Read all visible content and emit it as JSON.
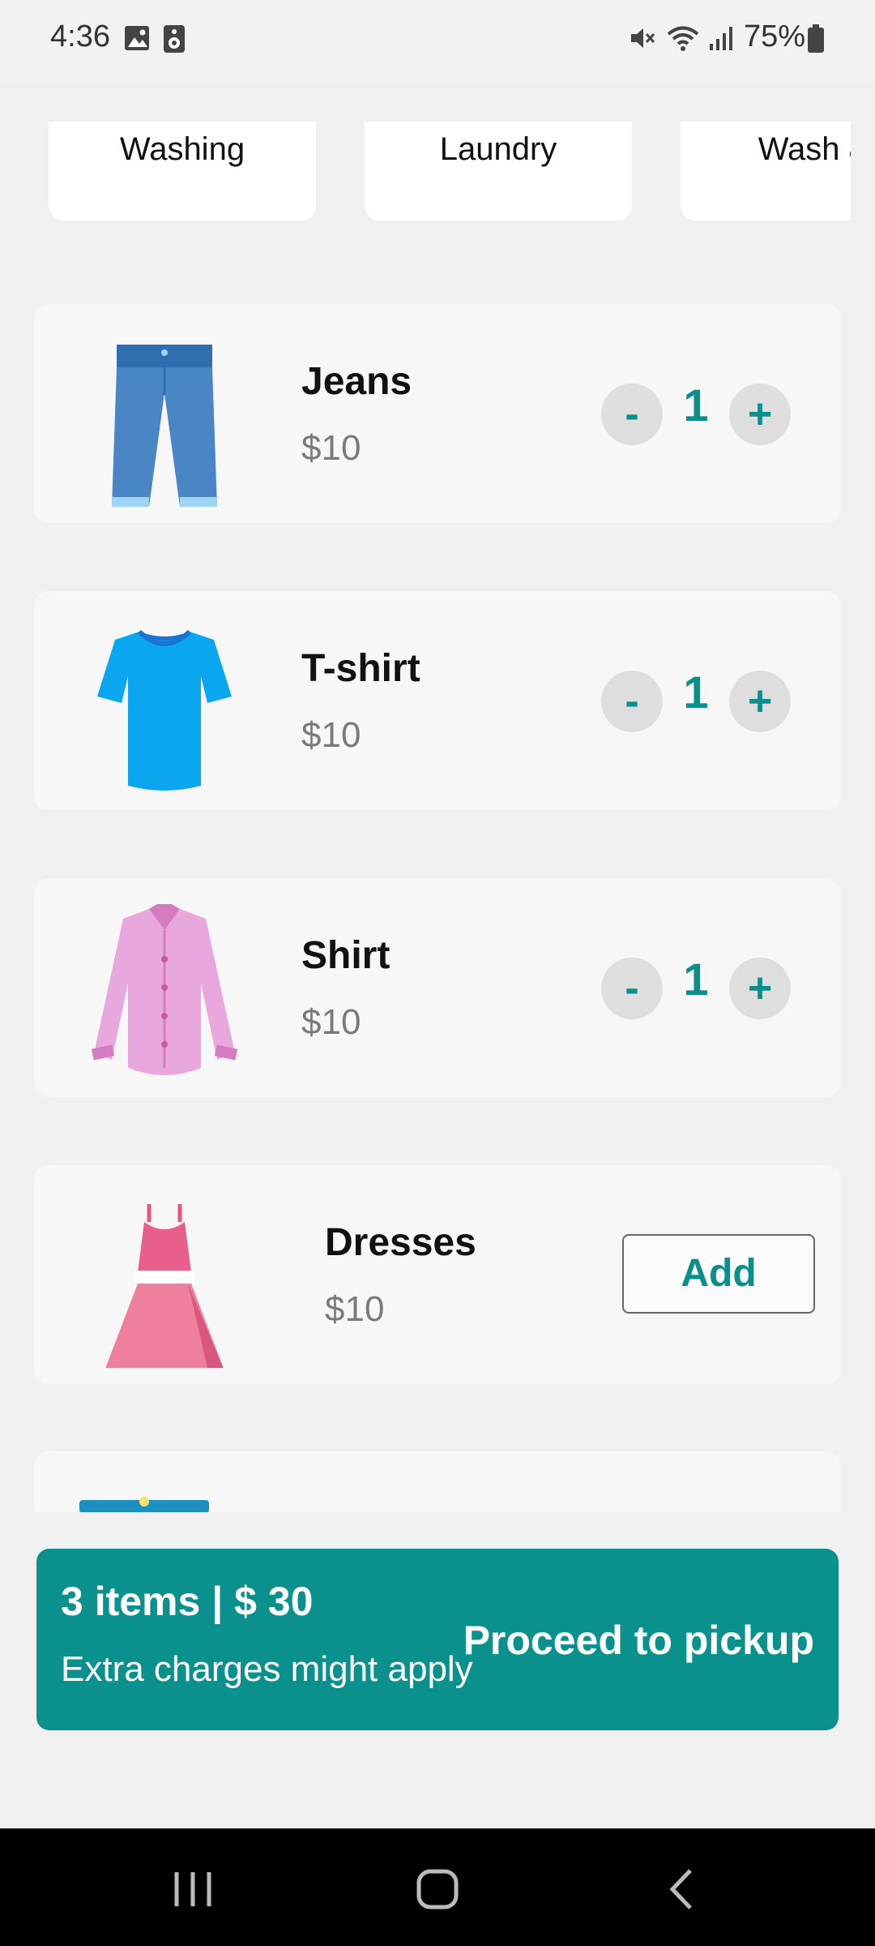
{
  "status_bar": {
    "time": "4:36",
    "battery": "75%",
    "icons": [
      "gallery-icon",
      "speaker-icon",
      "mute-icon",
      "wifi-icon",
      "signal-icon",
      "battery-icon"
    ]
  },
  "categories": [
    "Washing",
    "Laundry",
    "Wash &"
  ],
  "items": [
    {
      "name": "Jeans",
      "price": "$10",
      "quantity": "1",
      "icon": "jeans-icon"
    },
    {
      "name": "T-shirt",
      "price": "$10",
      "quantity": "1",
      "icon": "tshirt-icon"
    },
    {
      "name": "Shirt",
      "price": "$10",
      "quantity": "1",
      "icon": "shirt-icon"
    },
    {
      "name": "Dresses",
      "price": "$10",
      "add_label": "Add",
      "icon": "dress-icon"
    }
  ],
  "qty_controls": {
    "minus": "-",
    "plus": "+"
  },
  "cart": {
    "summary": "3 items | $ 30",
    "note": "Extra charges might apply",
    "proceed_label": "Proceed to pickup"
  },
  "colors": {
    "accent": "#0b918d",
    "qty_text": "#0b8f8c",
    "background": "#f0f0f0"
  }
}
